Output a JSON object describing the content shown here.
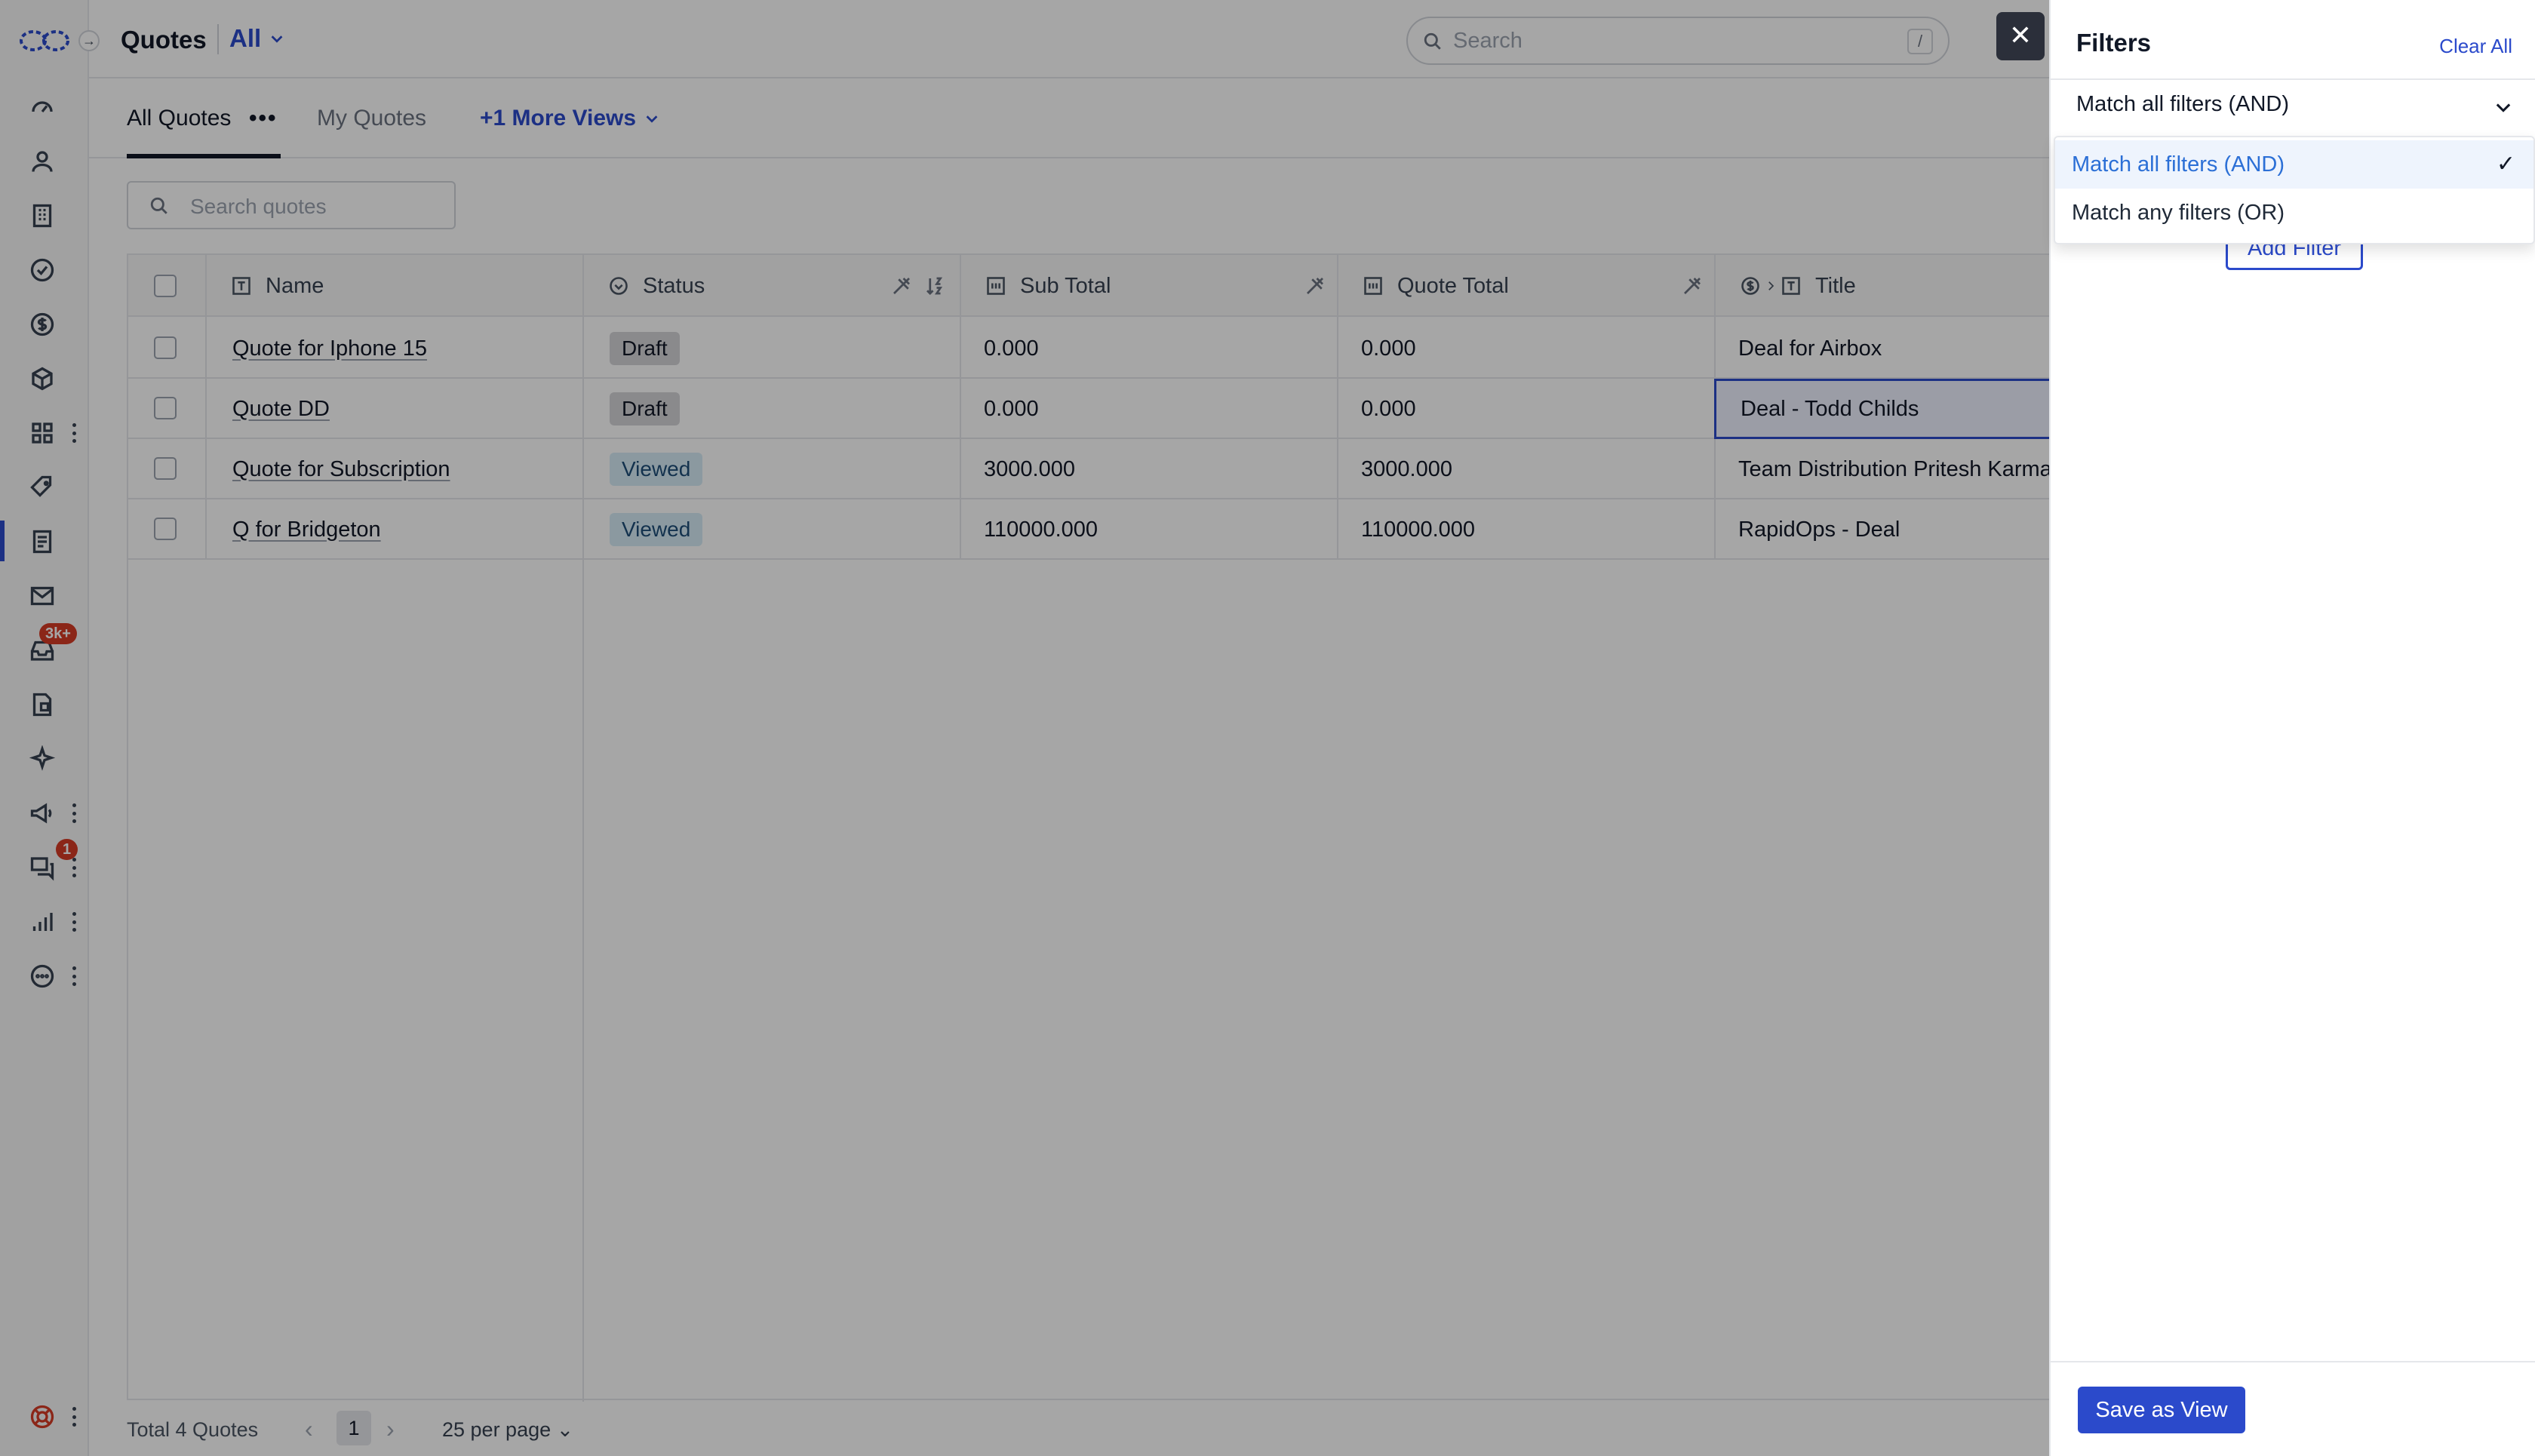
{
  "header": {
    "title": "Quotes",
    "view_selector": "All",
    "search_placeholder": "Search",
    "search_shortcut": "/"
  },
  "tabs": [
    {
      "label": "All Quotes"
    },
    {
      "label": "My Quotes"
    },
    {
      "label": "+1 More Views"
    }
  ],
  "quote_search": {
    "placeholder": "Search quotes"
  },
  "table": {
    "columns": [
      "Name",
      "Status",
      "Sub Total",
      "Quote Total",
      "Title"
    ],
    "rows": [
      {
        "name": "Quote for Iphone 15",
        "status": "Draft",
        "sub_total": "0.000",
        "quote_total": "0.000",
        "title": "Deal for Airbox"
      },
      {
        "name": "Quote DD",
        "status": "Draft",
        "sub_total": "0.000",
        "quote_total": "0.000",
        "title": "Deal - Todd Childs"
      },
      {
        "name": "Quote for Subscription",
        "status": "Viewed",
        "sub_total": "3000.000",
        "quote_total": "3000.000",
        "title": "Team Distribution Pritesh Karma"
      },
      {
        "name": "Q for Bridgeton",
        "status": "Viewed",
        "sub_total": "110000.000",
        "quote_total": "110000.000",
        "title": "RapidOps - Deal"
      }
    ]
  },
  "footer": {
    "total": "Total 4 Quotes",
    "current_page": "1",
    "per_page": "25 per page"
  },
  "sidebar": {
    "inbox_badge": "3k+",
    "chat_badge": "1"
  },
  "filter_panel": {
    "title": "Filters",
    "clear_all": "Clear All",
    "match_selected": "Match all filters (AND)",
    "options": [
      "Match all filters (AND)",
      "Match any filters (OR)"
    ],
    "add_filter": "Add Filter",
    "save_as_view": "Save as View"
  },
  "colors": {
    "accent": "#2b4acb",
    "draft_badge": "#d4d4d8",
    "viewed_badge": "#d6ecf6",
    "notification_badge": "#d63b25"
  }
}
